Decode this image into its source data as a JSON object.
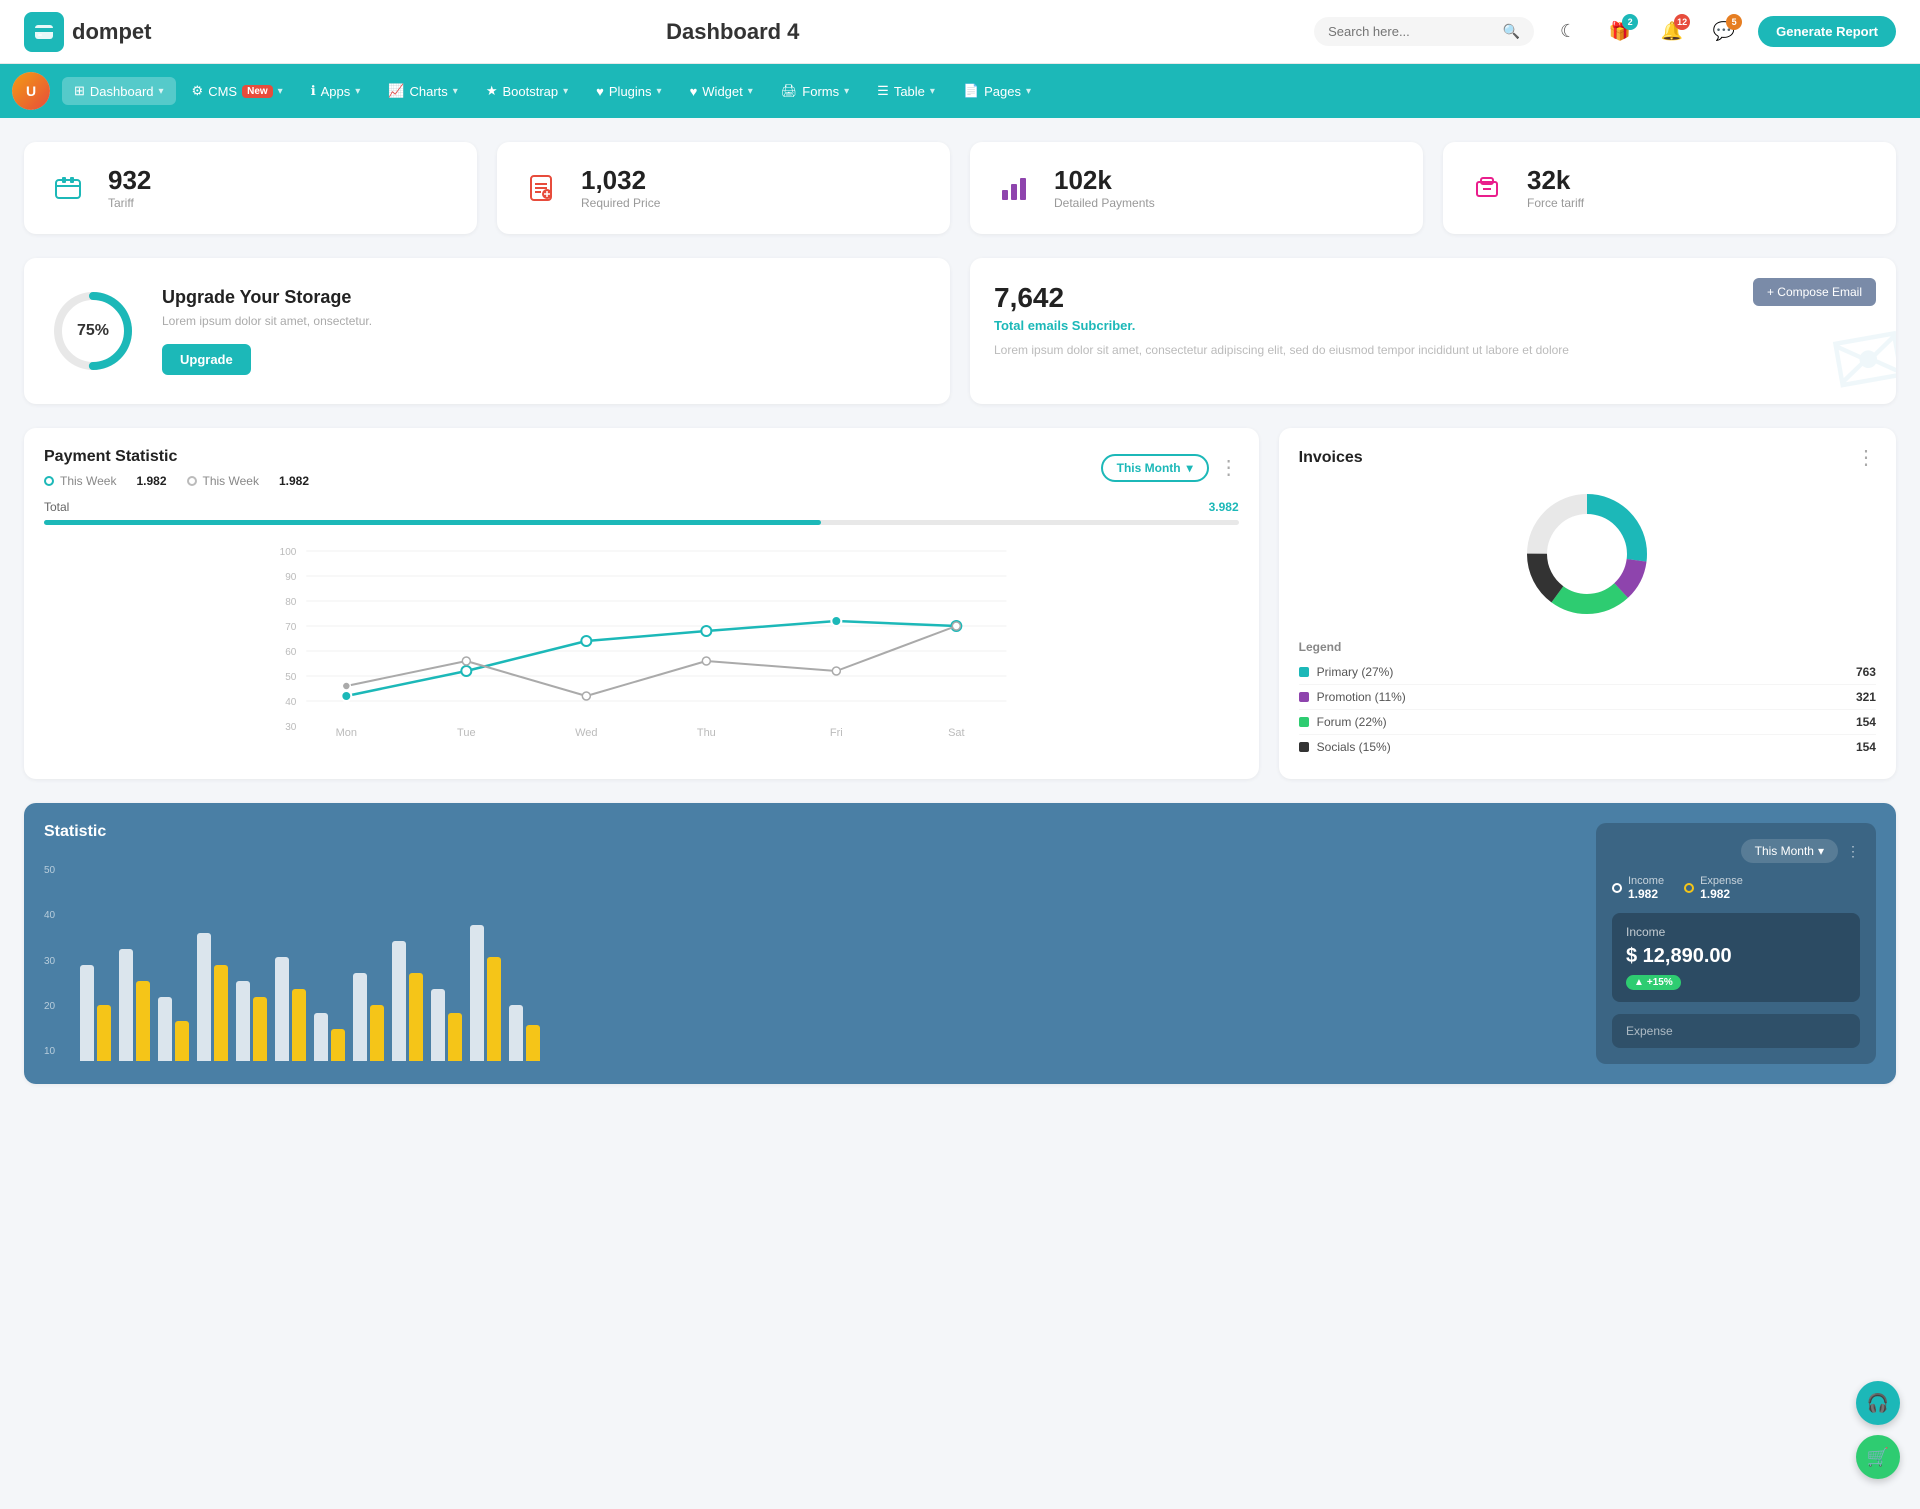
{
  "app": {
    "logo_text": "dompet",
    "page_title": "Dashboard 4",
    "generate_btn": "Generate Report"
  },
  "search": {
    "placeholder": "Search here..."
  },
  "header_icons": {
    "theme_icon": "☾",
    "gift_icon": "🎁",
    "gift_badge": "2",
    "notif_icon": "🔔",
    "notif_badge": "12",
    "chat_icon": "💬",
    "chat_badge": "5"
  },
  "nav": {
    "items": [
      {
        "id": "dashboard",
        "label": "Dashboard",
        "icon": "⊞",
        "active": true,
        "has_arrow": true
      },
      {
        "id": "cms",
        "label": "CMS",
        "icon": "⚙",
        "active": false,
        "has_arrow": true,
        "badge": "New"
      },
      {
        "id": "apps",
        "label": "Apps",
        "icon": "ℹ",
        "active": false,
        "has_arrow": true
      },
      {
        "id": "charts",
        "label": "Charts",
        "icon": "📈",
        "active": false,
        "has_arrow": true
      },
      {
        "id": "bootstrap",
        "label": "Bootstrap",
        "icon": "★",
        "active": false,
        "has_arrow": true
      },
      {
        "id": "plugins",
        "label": "Plugins",
        "icon": "♥",
        "active": false,
        "has_arrow": true
      },
      {
        "id": "widget",
        "label": "Widget",
        "icon": "♥",
        "active": false,
        "has_arrow": true
      },
      {
        "id": "forms",
        "label": "Forms",
        "icon": "🖨",
        "active": false,
        "has_arrow": true
      },
      {
        "id": "table",
        "label": "Table",
        "icon": "☰",
        "active": false,
        "has_arrow": true
      },
      {
        "id": "pages",
        "label": "Pages",
        "icon": "📄",
        "active": false,
        "has_arrow": true
      }
    ]
  },
  "stat_cards": [
    {
      "id": "tariff",
      "value": "932",
      "label": "Tariff",
      "icon": "🧳",
      "icon_class": "teal"
    },
    {
      "id": "required_price",
      "value": "1,032",
      "label": "Required Price",
      "icon": "📋",
      "icon_class": "red"
    },
    {
      "id": "detailed_payments",
      "value": "102k",
      "label": "Detailed Payments",
      "icon": "📊",
      "icon_class": "purple"
    },
    {
      "id": "force_tariff",
      "value": "32k",
      "label": "Force tariff",
      "icon": "🏢",
      "icon_class": "pink"
    }
  ],
  "storage": {
    "percent": "75%",
    "percent_num": 75,
    "title": "Upgrade Your Storage",
    "description": "Lorem ipsum dolor sit amet, onsectetur.",
    "btn_label": "Upgrade"
  },
  "email_card": {
    "number": "7,642",
    "subtitle": "Total emails Subcriber.",
    "description": "Lorem ipsum dolor sit amet, consectetur adipiscing elit, sed do eiusmod tempor incididunt ut labore et dolore",
    "compose_btn": "+ Compose Email"
  },
  "payment_chart": {
    "title": "Payment Statistic",
    "filter_label": "This Month",
    "legend": [
      {
        "label": "This Week",
        "value": "1.982",
        "color": "#1cb8b8"
      },
      {
        "label": "This Week",
        "value": "1.982",
        "color": "#bbb"
      }
    ],
    "total_label": "Total",
    "total_value": "3.982",
    "y_labels": [
      "100",
      "90",
      "80",
      "70",
      "60",
      "50",
      "40",
      "30"
    ],
    "x_labels": [
      "Mon",
      "Tue",
      "Wed",
      "Thu",
      "Fri",
      "Sat"
    ],
    "line1_points": "40,145 130,130 220,115 310,100 400,120 490,120 580,80 670,105",
    "line2_points": "40,120 130,105 220,95 310,80 400,85 490,85 580,60 670,85"
  },
  "invoices": {
    "title": "Invoices",
    "legend": [
      {
        "label": "Primary (27%)",
        "color": "#1cb8b8",
        "count": "763"
      },
      {
        "label": "Promotion (11%)",
        "color": "#8e44ad",
        "count": "321"
      },
      {
        "label": "Forum (22%)",
        "color": "#2ecc71",
        "count": "154"
      },
      {
        "label": "Socials (15%)",
        "color": "#222",
        "count": "154"
      }
    ],
    "legend_header": "Legend"
  },
  "statistic": {
    "title": "Statistic",
    "filter_label": "This Month",
    "income_label": "Income",
    "income_value": "1.982",
    "expense_label": "Expense",
    "expense_value": "1.982",
    "income_amount": "$ 12,890.00",
    "income_badge": "+15%",
    "expense_title": "Expense",
    "y_labels": [
      "50",
      "40",
      "30",
      "20",
      "10"
    ],
    "x_labels": [
      "",
      "",
      "",
      "",
      "",
      "",
      "",
      "",
      "",
      "",
      "",
      ""
    ],
    "bars": [
      {
        "white": 60,
        "yellow": 35
      },
      {
        "white": 70,
        "yellow": 50
      },
      {
        "white": 40,
        "yellow": 25
      },
      {
        "white": 80,
        "yellow": 60
      },
      {
        "white": 50,
        "yellow": 40
      },
      {
        "white": 65,
        "yellow": 45
      },
      {
        "white": 30,
        "yellow": 20
      },
      {
        "white": 55,
        "yellow": 35
      },
      {
        "white": 75,
        "yellow": 55
      },
      {
        "white": 45,
        "yellow": 30
      },
      {
        "white": 85,
        "yellow": 65
      },
      {
        "white": 35,
        "yellow": 22
      }
    ]
  }
}
